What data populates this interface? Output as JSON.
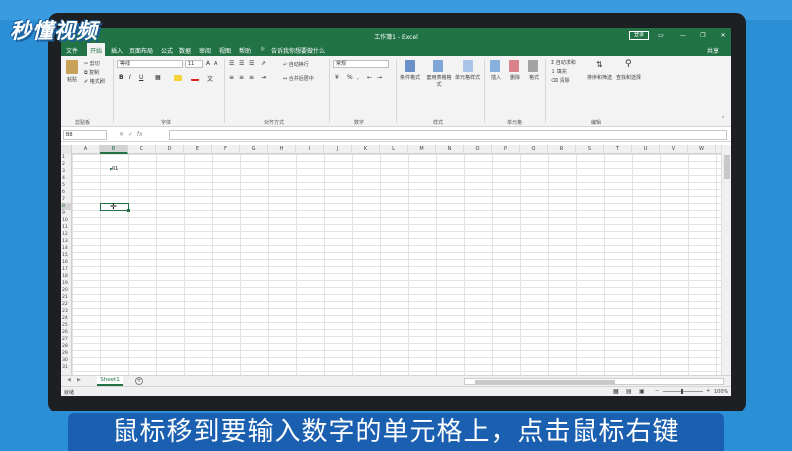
{
  "logo": {
    "text": "秒懂视频"
  },
  "window": {
    "title": "工作簿1 - Excel",
    "login_label": "登录",
    "controls": [
      "▭",
      "—",
      "❐",
      "✕"
    ]
  },
  "menu": {
    "items": [
      "文件",
      "开始",
      "插入",
      "页面布局",
      "公式",
      "数据",
      "审阅",
      "视图",
      "帮助"
    ],
    "active": "开始",
    "search_hint": "告诉我你想要做什么",
    "share_label": "共享"
  },
  "ribbon": {
    "clipboard": {
      "paste": "粘贴",
      "cut": "剪切",
      "copy": "复制",
      "format_painter": "格式刷",
      "group": "剪贴板"
    },
    "font": {
      "font_name": "等线",
      "font_size": "11",
      "bold": "B",
      "italic": "I",
      "underline": "U",
      "group": "字体",
      "grow": "A",
      "shrink": "A"
    },
    "alignment": {
      "wrap_text": "自动换行",
      "merge_center": "合并后居中",
      "group": "对齐方式"
    },
    "number": {
      "format": "常规",
      "percent": "%",
      "group": "数字"
    },
    "styles": {
      "conditional": "条件格式",
      "table_format": "套用表格格式",
      "cell_styles": "单元格样式",
      "group": "样式"
    },
    "cells": {
      "insert": "插入",
      "delete": "删除",
      "format": "格式",
      "group": "单元格"
    },
    "editing": {
      "autosum": "自动求和",
      "fill": "填充",
      "clear": "清除",
      "sort_filter": "排序和筛选",
      "find_select": "查找和选择",
      "group": "编辑"
    }
  },
  "formula_bar": {
    "name_box": "B8",
    "fx": "fx",
    "cancel": "✕",
    "enter": "✓"
  },
  "grid": {
    "columns": [
      "A",
      "B",
      "C",
      "D",
      "E",
      "F",
      "G",
      "H",
      "I",
      "J",
      "K",
      "L",
      "M",
      "N",
      "O",
      "P",
      "Q",
      "R",
      "S",
      "T",
      "U",
      "V",
      "W"
    ],
    "rows": [
      "1",
      "2",
      "3",
      "4",
      "5",
      "6",
      "7",
      "8",
      "9",
      "10",
      "11",
      "12",
      "13",
      "14",
      "15",
      "16",
      "17",
      "18",
      "19",
      "20",
      "21",
      "22",
      "23",
      "24",
      "25",
      "26",
      "27",
      "28",
      "29",
      "30",
      "31"
    ],
    "selected_column": "B",
    "selected_row": "8",
    "cell_b3": "01"
  },
  "sheets": {
    "tabs": [
      "Sheet1"
    ],
    "add": "+"
  },
  "status": {
    "ready": "就绪",
    "zoom": "100%"
  },
  "subtitle": "鼠标移到要输入数字的单元格上，点击鼠标右键"
}
